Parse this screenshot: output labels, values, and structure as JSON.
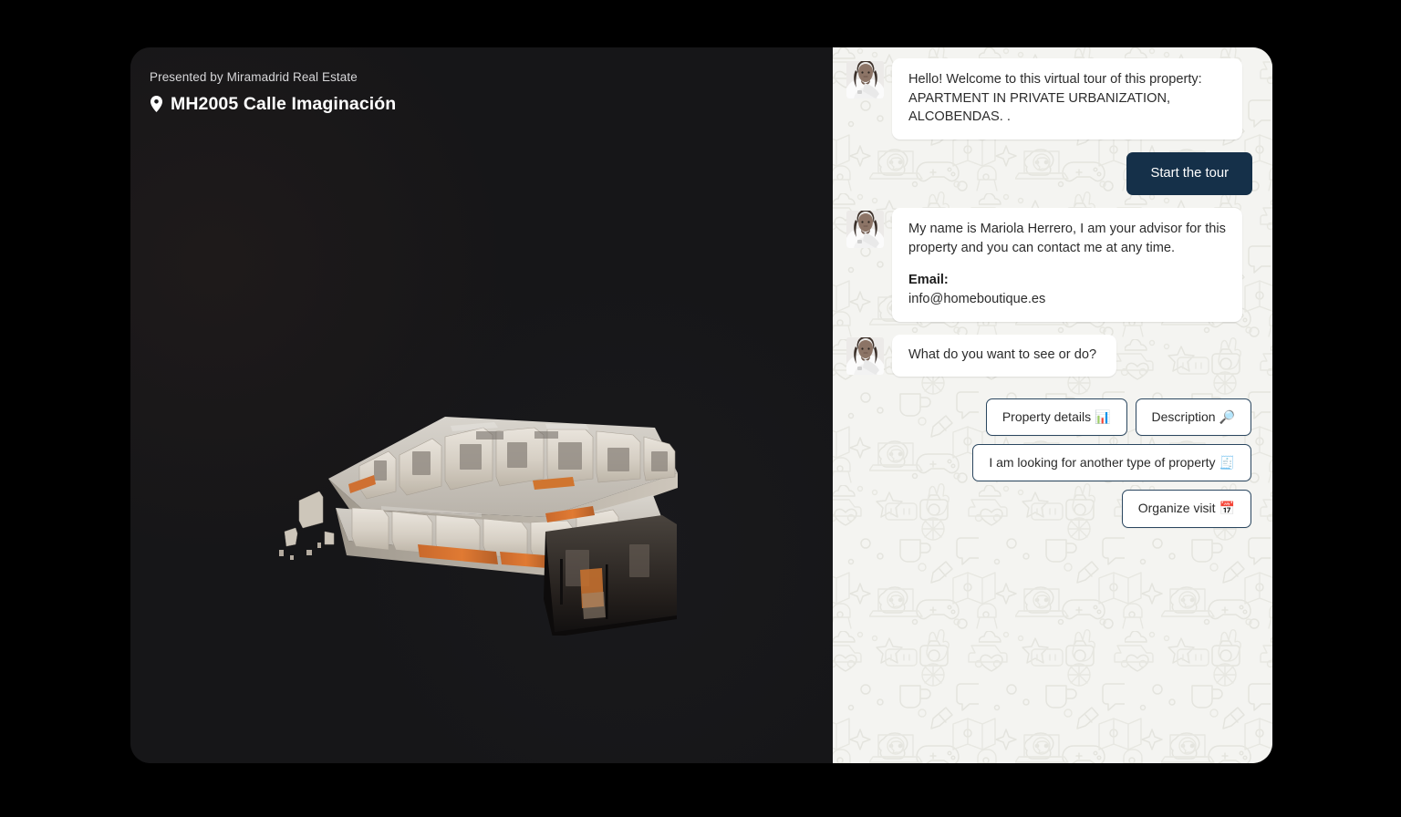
{
  "viewer": {
    "presented_by": "Presented by Miramadrid Real Estate",
    "pin_icon": "location-pin-icon",
    "property_title": "MH2005 Calle Imaginación",
    "model_description": "3D dollhouse floor plan of apartment",
    "background_color": "#161618"
  },
  "chat": {
    "background_color": "#f4f4f1",
    "accent_color": "#153049",
    "avatar_alt": "advisor-photo",
    "messages": [
      {
        "id": "welcome",
        "line1": "Hello! Welcome to this virtual tour of this property:",
        "line2": "APARTMENT IN PRIVATE URBANIZATION,",
        "line3": "ALCOBENDAS. ."
      },
      {
        "id": "advisor",
        "line1": "My name is  Mariola Herrero, I  am your advisor for this",
        "line2": "property and you can contact me at any time.",
        "email_label": "Email:",
        "email_value": "info@homeboutique.es"
      },
      {
        "id": "prompt",
        "line1": "What do you want to see or do?"
      }
    ],
    "start_tour_label": "Start the tour",
    "quick_replies": [
      {
        "label": "Property details",
        "emoji": "📊",
        "icon_name": "bar-chart-emoji"
      },
      {
        "label": "Description",
        "emoji": "🔎",
        "icon_name": "magnifier-emoji"
      },
      {
        "label": "I am looking for another type of property",
        "emoji": "🧾",
        "icon_name": "document-emoji"
      },
      {
        "label": "Organize  visit",
        "emoji": "📅",
        "icon_name": "calendar-emoji"
      }
    ]
  }
}
